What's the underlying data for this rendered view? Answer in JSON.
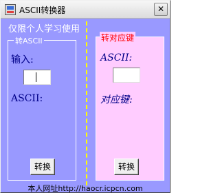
{
  "window": {
    "title": "ASCII转换器",
    "close_glyph": "✕"
  },
  "caption": "仅限个人学习使用",
  "left_panel": {
    "legend": "转ASCII",
    "input_label": "输入:",
    "input_value": "",
    "output_label": "ASCII:",
    "button_label": "转换"
  },
  "right_panel": {
    "legend": "转对应键",
    "input_label": "ASCII:",
    "input_value": "",
    "output_label": "对应键:",
    "button_label": "转换"
  },
  "footer": "本人网址http://haocr.icpcn.com",
  "colors": {
    "background": "#9999ff",
    "right_panel": "#ffccff",
    "divider": "#ffff00",
    "label_text": "#000088",
    "right_legend": "#ff0000"
  }
}
